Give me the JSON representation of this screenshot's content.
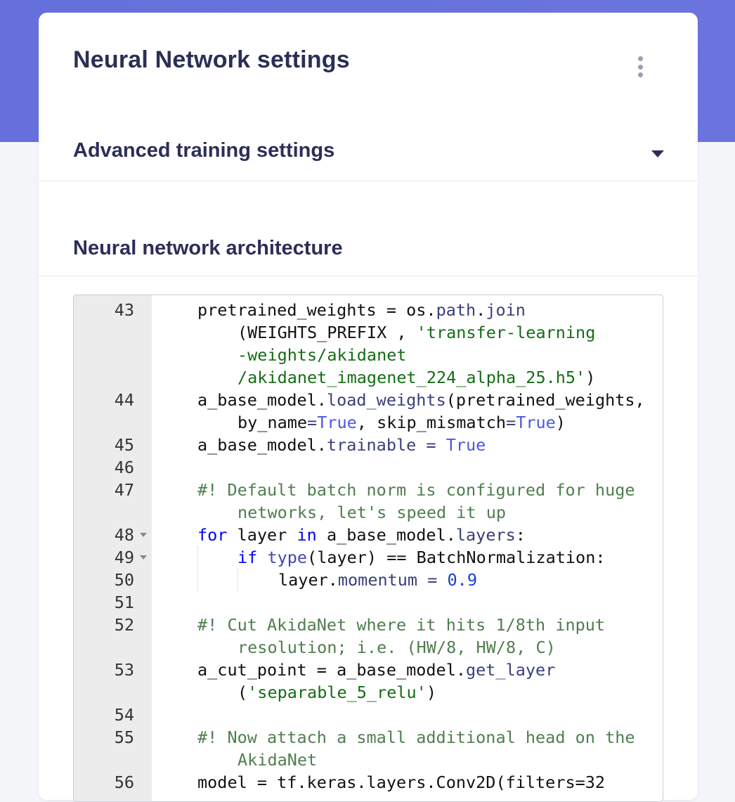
{
  "page": {
    "title": "Neural Network settings",
    "menu_icon": "kebab-vertical-icon"
  },
  "sections": {
    "advanced": {
      "label": "Advanced training settings",
      "icon": "caret-down-icon"
    },
    "architecture": {
      "label": "Neural network architecture"
    }
  },
  "editor": {
    "lines": {
      "l43": {
        "n": "43",
        "a": "pretrained_weights = os.",
        "b": "path",
        "c": ".",
        "d": "join",
        "w1": "(WEIGHTS_PREFIX , ",
        "s1": "'transfer-learning",
        "s2": "-weights/akidanet",
        "s3": "/akidanet_imagenet_224_alpha_25.h5'",
        "e3": ")"
      },
      "l44": {
        "n": "44",
        "a": "a_base_model.",
        "b": "load_weights",
        "c": "(pretrained_weights,",
        "w1": "by_name",
        "w2": "=",
        "w3": "True",
        "w4": ", skip_mismatch",
        "w5": "=",
        "w6": "True",
        "w7": ")"
      },
      "l45": {
        "n": "45",
        "a": "a_base_model.",
        "b": "trainable",
        "c": " = ",
        "d": "True"
      },
      "l46": {
        "n": "46"
      },
      "l47": {
        "n": "47",
        "a": "#! Default batch norm is configured for huge",
        "w1": "networks, let's speed it up"
      },
      "l48": {
        "n": "48",
        "a": "for",
        "b": " layer ",
        "c": "in",
        "d": " a_base_model.",
        "e": "layers",
        "f": ":"
      },
      "l49": {
        "n": "49",
        "a": "if",
        "b": " ",
        "c": "type",
        "d": "(layer) == BatchNormalization:"
      },
      "l50": {
        "n": "50",
        "a": "layer.",
        "b": "momentum",
        "c": " = ",
        "d": "0.9"
      },
      "l51": {
        "n": "51"
      },
      "l52": {
        "n": "52",
        "a": "#! Cut AkidaNet where it hits 1/8th input",
        "w1": "resolution; i.e. (HW/8, HW/8, C)"
      },
      "l53": {
        "n": "53",
        "a": "a_cut_point = a_base_model.",
        "b": "get_layer",
        "w1": "(",
        "w2": "'separable_5_relu'",
        "w3": ")"
      },
      "l54": {
        "n": "54"
      },
      "l55": {
        "n": "55",
        "a": "#! Now attach a small additional head on the",
        "w1": "AkidaNet"
      },
      "l56": {
        "n": "56",
        "a": "model = tf.keras.layers.Conv2D(filters=32"
      }
    }
  }
}
